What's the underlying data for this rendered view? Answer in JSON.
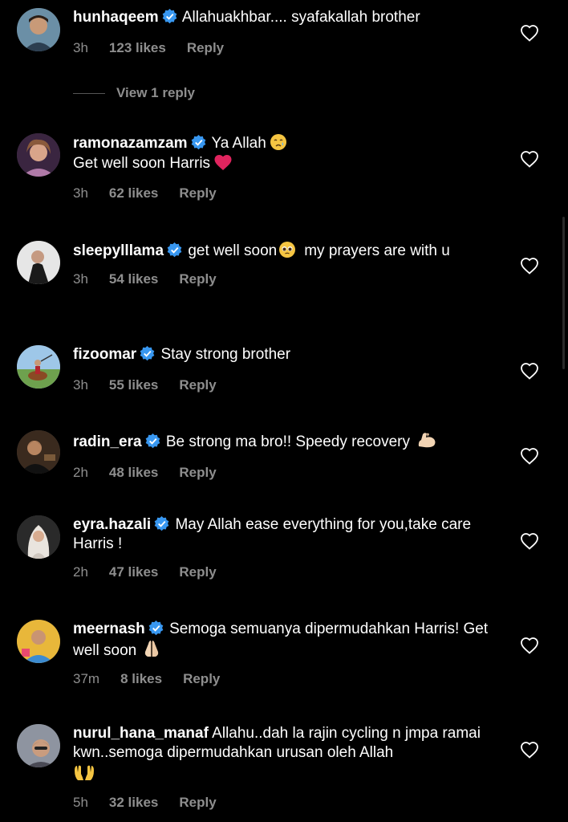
{
  "comments": [
    {
      "username": "hunhaqeem",
      "text": "Allahuakhbar.... syafakallah brother",
      "time": "3h",
      "likes": "123 likes",
      "reply": "Reply",
      "avatar_color": "#6b8fa6"
    },
    {
      "username": "ramonazamzam",
      "text": "Ya Allah",
      "text2": "Get well soon Harris",
      "time": "3h",
      "likes": "62 likes",
      "reply": "Reply",
      "avatar_color": "#8a5a7c"
    },
    {
      "username": "sleepylllama",
      "text": "get well soon",
      "text2": "my prayers are with u",
      "time": "3h",
      "likes": "54 likes",
      "reply": "Reply",
      "avatar_color": "#d8d8d8"
    },
    {
      "username": "fizoomar",
      "text": "Stay strong brother",
      "time": "3h",
      "likes": "55 likes",
      "reply": "Reply",
      "avatar_color": "#8ab57a"
    },
    {
      "username": "radin_era",
      "text": "Be strong ma bro!! Speedy recovery",
      "time": "2h",
      "likes": "48 likes",
      "reply": "Reply",
      "avatar_color": "#5a4432"
    },
    {
      "username": "eyra.hazali",
      "text": "May Allah ease everything for you,take care Harris !",
      "time": "2h",
      "likes": "47 likes",
      "reply": "Reply",
      "avatar_color": "#c7c1bb"
    },
    {
      "username": "meernash",
      "text": "Semoga semuanya dipermudahkan Harris! Get well soon",
      "time": "37m",
      "likes": "8 likes",
      "reply": "Reply",
      "avatar_color": "#e0b53a"
    },
    {
      "username": "nurul_hana_manaf",
      "text": "Allahu..dah la rajin cycling n jmpa ramai kwn..semoga dipermudahkan urusan oleh Allah",
      "time": "5h",
      "likes": "32 likes",
      "reply": "Reply",
      "avatar_color": "#a0a0a8"
    }
  ],
  "view_replies": "View 1 reply",
  "icons": {
    "verified": "verified-badge-icon",
    "heart": "heart-outline-icon"
  },
  "colors": {
    "background": "#000000",
    "muted": "#8e8e8e",
    "verified": "#3897f0"
  }
}
